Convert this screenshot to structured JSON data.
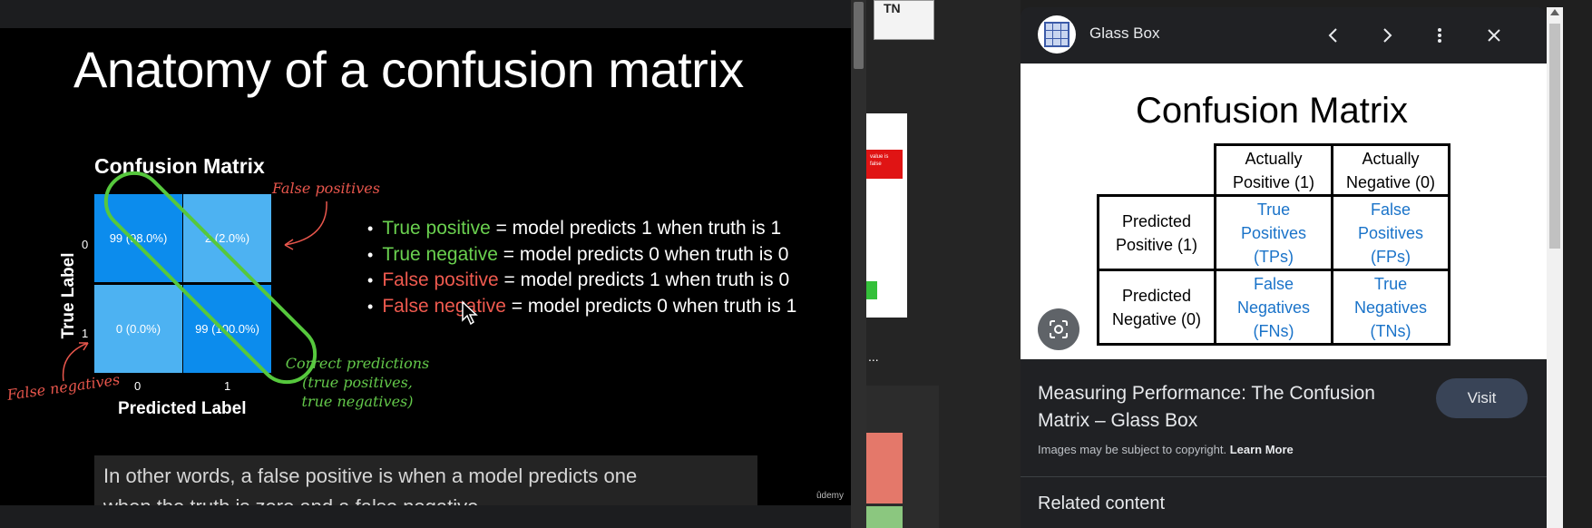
{
  "video": {
    "slide_title": "Anatomy of a confusion matrix",
    "matrix_title": "Confusion Matrix",
    "y_axis_label": "True Label",
    "x_axis_label": "Predicted Label",
    "y_ticks": [
      "0",
      "1"
    ],
    "x_ticks": [
      "0",
      "1"
    ],
    "cells": [
      "99 (98.0%)",
      "2 (2.0%)",
      "0 (0.0%)",
      "99 (100.0%)"
    ],
    "annotations": {
      "false_positives": "False positives",
      "false_negatives": "False negatives",
      "correct_1": "Correct predictions",
      "correct_2": "(true positives,",
      "correct_3": "true negatives)"
    },
    "bullets": [
      {
        "term": "True positive",
        "rest": " = model predicts 1 when truth is 1"
      },
      {
        "term": "True negative",
        "rest": " = model predicts 0 when truth is 0"
      },
      {
        "term": "False positive",
        "rest": " = model predicts 1 when truth is 0"
      },
      {
        "term": "False negative",
        "rest": " = model predicts 0 when truth is 1"
      }
    ],
    "caption_line1": "In other words, a false positive is when a model predicts one",
    "caption_line2": "when the truth is zero and a false negative",
    "watermark": "ûdemy",
    "colors": {
      "correct": "#6ad14f",
      "error": "#ef5a4f",
      "cell_dark": "#0c8ced",
      "cell_light": "#4db2f2"
    }
  },
  "strip": {
    "tn_label": "TN",
    "red_tag_text": "value is false",
    "ellipsis": "..."
  },
  "lens": {
    "site_name": "Glass Box",
    "icons": {
      "back": "chevron-left-icon",
      "forward": "chevron-right-icon",
      "more": "more-vert-icon",
      "close": "close-icon",
      "lens": "google-lens-icon"
    },
    "image": {
      "title": "Confusion Matrix",
      "col_headers": [
        [
          "Actually",
          "Positive (1)"
        ],
        [
          "Actually",
          "Negative (0)"
        ]
      ],
      "rows": [
        {
          "header": [
            "Predicted",
            "Positive (1)"
          ],
          "cells": [
            [
              "True",
              "Positives",
              "(TPs)"
            ],
            [
              "False",
              "Positives",
              "(FPs)"
            ]
          ]
        },
        {
          "header": [
            "Predicted",
            "Negative (0)"
          ],
          "cells": [
            [
              "False",
              "Negatives",
              "(FNs)"
            ],
            [
              "True",
              "Negatives",
              "(TNs)"
            ]
          ]
        }
      ]
    },
    "result_title": "Measuring Performance: The Confusion Matrix – Glass Box",
    "visit_label": "Visit",
    "copyright_text": "Images may be subject to copyright. ",
    "learn_more": "Learn More",
    "related_heading": "Related content"
  }
}
